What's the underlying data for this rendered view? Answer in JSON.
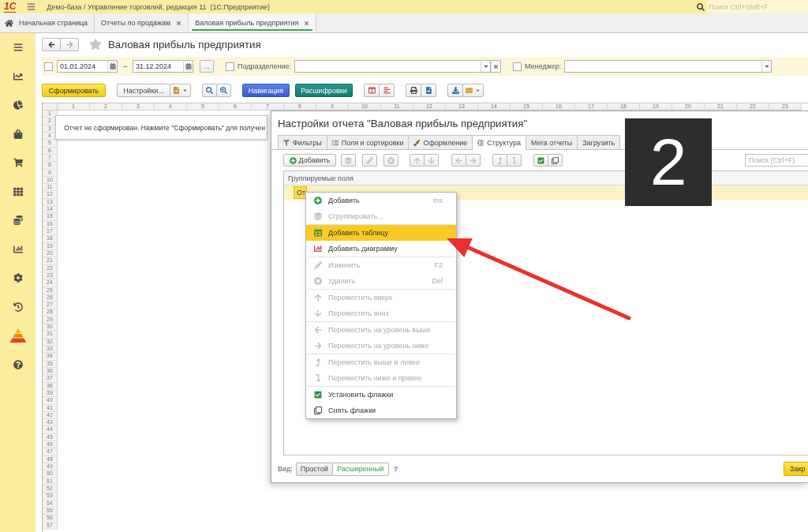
{
  "app_bar": {
    "logo": "1С",
    "title": "Демо-база / Управление торговлей, редакция 11  (1С:Предприятие)",
    "search": {
      "placeholder": "Поиск Ctrl+Shift+F"
    }
  },
  "tabs": [
    {
      "kind": "home",
      "label": "Начальная страница",
      "selected": false
    },
    {
      "kind": "page",
      "label": "Отчеты по продажам",
      "selected": false
    },
    {
      "kind": "page",
      "label": "Валовая прибыль предприятия",
      "selected": true
    }
  ],
  "page": {
    "title": "Валовая прибыль предприятия",
    "favorite": false
  },
  "filter_bar": {
    "period": {
      "checked": false,
      "from": "01.01.2024",
      "dash": "–",
      "to": "31.12.2024",
      "choose_button": "..."
    },
    "fields": [
      {
        "label": "Подразделение:",
        "checked": false,
        "clearable": true
      },
      {
        "label": "Менеджер:",
        "checked": false,
        "clearable": false
      }
    ]
  },
  "toolbar": {
    "generate": "Сформировать",
    "settings": "Настройки...",
    "navigation": "Навигация",
    "drilldown": "Расшифровки"
  },
  "spreadsheet": {
    "columns": [
      "1",
      "2",
      "3",
      "4",
      "5",
      "6",
      "7",
      "8",
      "9",
      "10",
      "11",
      "12",
      "13",
      "14",
      "15",
      "16",
      "17",
      "18",
      "19",
      "20",
      "21",
      "22",
      "23"
    ],
    "rows": [
      "1",
      "2",
      "3",
      "4",
      "5",
      "6",
      "7",
      "8",
      "9",
      "10",
      "11",
      "12",
      "13",
      "14",
      "15",
      "16",
      "17",
      "18",
      "19",
      "20",
      "21",
      "22",
      "23",
      "24",
      "25",
      "26",
      "27",
      "28",
      "29",
      "30",
      "31",
      "32",
      "33",
      "34",
      "35",
      "36",
      "37",
      "38",
      "39",
      "40",
      "41",
      "42",
      "43",
      "44",
      "45",
      "46",
      "47",
      "48",
      "49",
      "50",
      "51",
      "52",
      "53",
      "54",
      "55",
      "56",
      "57"
    ],
    "message": "Отчет не сформирован. Нажмите \"Сформировать\" для получен"
  },
  "dialog": {
    "title": "Настройки отчета \"Валовая прибыль предприятия\"",
    "tabs": [
      {
        "label": "Фильтры",
        "selected": false
      },
      {
        "label": "Поля и сортировки",
        "selected": false
      },
      {
        "label": "Оформление",
        "selected": false
      },
      {
        "label": "Структура",
        "selected": true
      },
      {
        "label": "Мега отчеты",
        "selected": false
      },
      {
        "label": "Загрузить",
        "selected": false
      }
    ],
    "toolbar": {
      "add": "Добавить",
      "icon_buttons": [
        {
          "disabled": true
        },
        {
          "disabled": true
        },
        {
          "disabled": true
        },
        {
          "disabled": true
        },
        {
          "disabled": true
        },
        {
          "disabled": true
        },
        {
          "disabled": true
        },
        {
          "disabled": true
        },
        {
          "disabled": true
        },
        {
          "disabled": false
        },
        {
          "disabled": false
        }
      ],
      "search": {
        "placeholder": "Поиск (Ctrl+F)"
      }
    },
    "table": {
      "columns": [
        "Группируемые поля"
      ],
      "rows": [
        {
          "label": "От",
          "selected": true
        }
      ]
    },
    "footer": {
      "view_label": "Вид:",
      "modes": [
        {
          "label": "Простой",
          "selected": false
        },
        {
          "label": "Расширенный",
          "selected": true
        }
      ],
      "help": "?",
      "close": "Закр"
    }
  },
  "context_menu": {
    "groups": [
      [
        {
          "label": "Добавить",
          "shortcut": "Ins",
          "disabled": false,
          "selected": false
        },
        {
          "label": "Сгруппировать...",
          "disabled": true,
          "selected": false
        }
      ],
      [
        {
          "label": "Добавить таблицу",
          "disabled": false,
          "selected": true
        },
        {
          "label": "Добавить диаграмму",
          "disabled": false,
          "selected": false
        }
      ],
      [
        {
          "label": "Изменить",
          "shortcut": "F2",
          "disabled": true,
          "selected": false
        },
        {
          "label": "Удалить",
          "shortcut": "Del",
          "disabled": true,
          "selected": false
        }
      ],
      [
        {
          "label": "Переместить вверх",
          "disabled": true,
          "selected": false
        },
        {
          "label": "Переместить вниз",
          "disabled": true,
          "selected": false
        }
      ],
      [
        {
          "label": "Переместить на уровень выше",
          "disabled": true,
          "selected": false
        },
        {
          "label": "Переместить на уровень ниже",
          "disabled": true,
          "selected": false
        }
      ],
      [
        {
          "label": "Переместить выше и левее",
          "disabled": true,
          "selected": false
        },
        {
          "label": "Переместить ниже и правее",
          "disabled": true,
          "selected": false
        }
      ],
      [
        {
          "label": "Установить флажки",
          "disabled": false,
          "selected": false
        },
        {
          "label": "Снять флажки",
          "disabled": false,
          "selected": false
        }
      ]
    ]
  },
  "annotation": {
    "step": "2"
  }
}
